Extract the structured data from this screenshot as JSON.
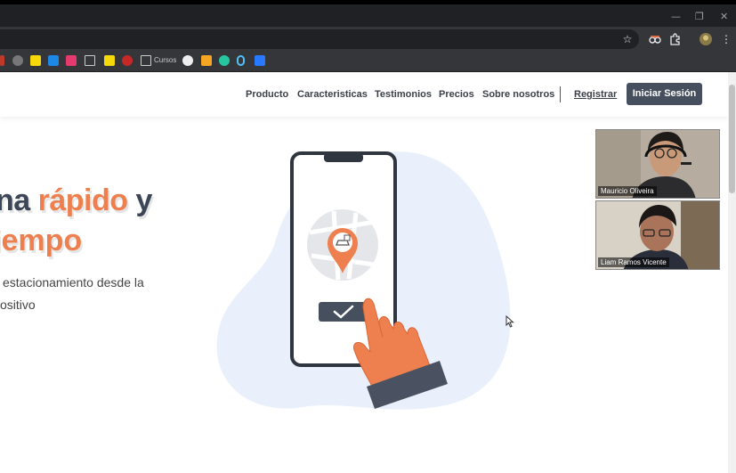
{
  "window": {
    "minimize": "—",
    "restore": "❐",
    "close": "✕"
  },
  "toolbar": {
    "star_icon": "star-icon",
    "extensions_icon": "puzzle-icon",
    "menu_icon": "more-vert-icon"
  },
  "bookmarks": {
    "folder_label": "Cursos"
  },
  "nav": {
    "links": [
      "Producto",
      "Caracteristicas",
      "Testimonios",
      "Precios",
      "Sobre nosotros"
    ],
    "register": "Registrar",
    "login": "Iniciar Sesión"
  },
  "hero": {
    "title_part1": "na ",
    "title_highlight": "rápido",
    "title_part2": " y",
    "title_line2": "iempo",
    "subtitle_line1": "estacionamiento desde la",
    "subtitle_line2": "ositivo"
  },
  "colors": {
    "accent": "#ee8050",
    "dark": "#454f5e",
    "blob": "#eaf0fb"
  },
  "video_call": {
    "participants": [
      {
        "name": "Mauricio Oliveira"
      },
      {
        "name": "Liam Ramos Vicente"
      }
    ]
  }
}
